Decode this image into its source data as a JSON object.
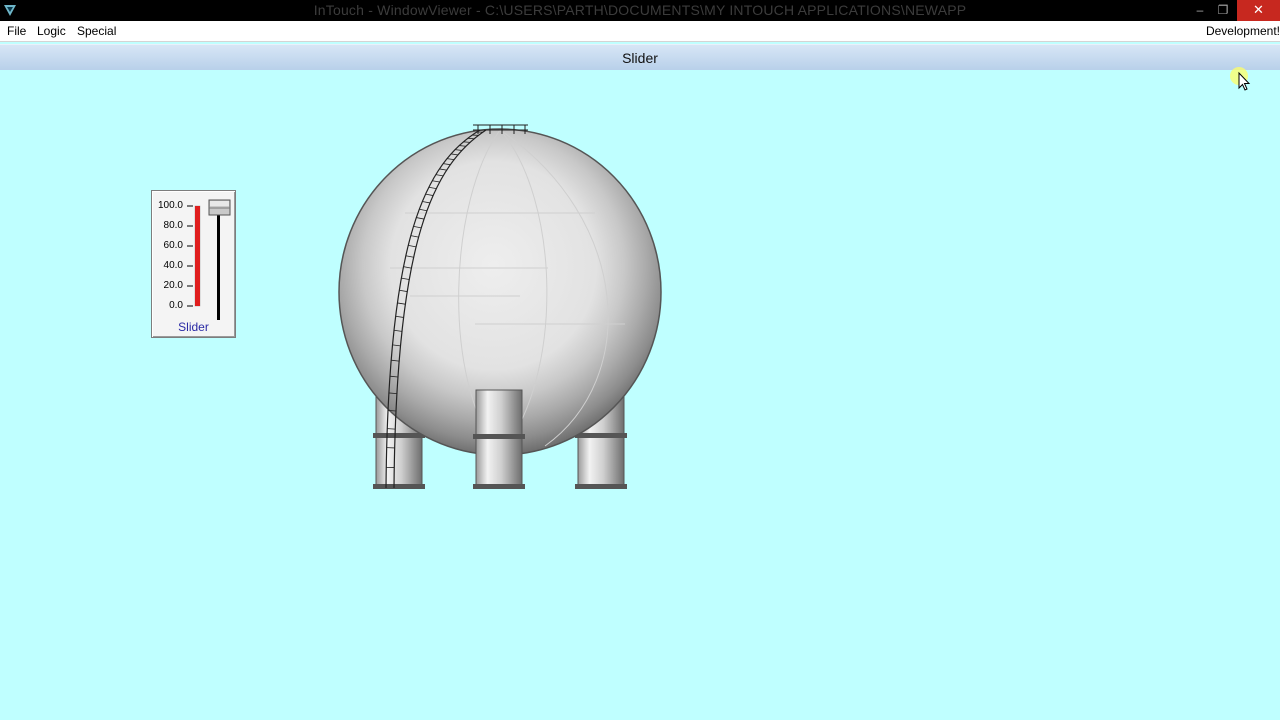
{
  "titlebar": {
    "title": "InTouch - WindowViewer - C:\\USERS\\PARTH\\DOCUMENTS\\MY INTOUCH APPLICATIONS\\NEWAPP",
    "icons": [
      "intouch-app-icon",
      "minimize-icon",
      "restore-icon",
      "close-icon"
    ],
    "minimize_glyph": "–",
    "restore_glyph": "❐",
    "close_glyph": "✕"
  },
  "menubar": {
    "items": [
      {
        "label": "File"
      },
      {
        "label": "Logic"
      },
      {
        "label": "Special"
      }
    ],
    "right_label": "Development!"
  },
  "window": {
    "title": "Slider"
  },
  "slider": {
    "label": "Slider",
    "ticks": [
      "100.0",
      "80.0",
      "60.0",
      "40.0",
      "20.0",
      "0.0"
    ],
    "value_percent": 100,
    "bar_color": "#e01e1e",
    "label_color": "#2a2aa5"
  },
  "colors": {
    "canvas": "#bfffff",
    "titlebar": "#000000",
    "close_button": "#c7281f"
  }
}
